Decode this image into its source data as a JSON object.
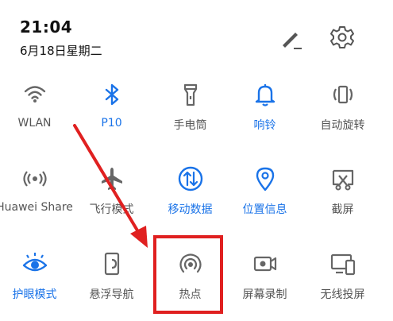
{
  "status": {
    "time": "21:04",
    "date": "6月18日星期二"
  },
  "header_icons": {
    "edit": "edit-pencil-icon",
    "settings": "gear-icon"
  },
  "colors": {
    "active": "#1a73e8",
    "inactive": "#666666",
    "annotation": "#e02020"
  },
  "tiles": [
    {
      "label": "WLAN",
      "icon": "wifi-icon",
      "active": false
    },
    {
      "label": "P10",
      "icon": "bluetooth-icon",
      "active": true
    },
    {
      "label": "手电筒",
      "icon": "flashlight-icon",
      "active": false
    },
    {
      "label": "响铃",
      "icon": "bell-icon",
      "active": true
    },
    {
      "label": "自动旋转",
      "icon": "auto-rotate-icon",
      "active": false
    },
    {
      "label": "Huawei Share",
      "icon": "huawei-share-icon",
      "active": false
    },
    {
      "label": "飞行模式",
      "icon": "airplane-icon",
      "active": false
    },
    {
      "label": "移动数据",
      "icon": "mobile-data-icon",
      "active": true
    },
    {
      "label": "位置信息",
      "icon": "location-icon",
      "active": true
    },
    {
      "label": "截屏",
      "icon": "screenshot-icon",
      "active": false
    },
    {
      "label": "护眼模式",
      "icon": "eye-comfort-icon",
      "active": true
    },
    {
      "label": "悬浮导航",
      "icon": "floating-nav-icon",
      "active": false
    },
    {
      "label": "热点",
      "icon": "hotspot-icon",
      "active": false
    },
    {
      "label": "屏幕录制",
      "icon": "screen-record-icon",
      "active": false
    },
    {
      "label": "无线投屏",
      "icon": "wireless-projection-icon",
      "active": false
    }
  ]
}
